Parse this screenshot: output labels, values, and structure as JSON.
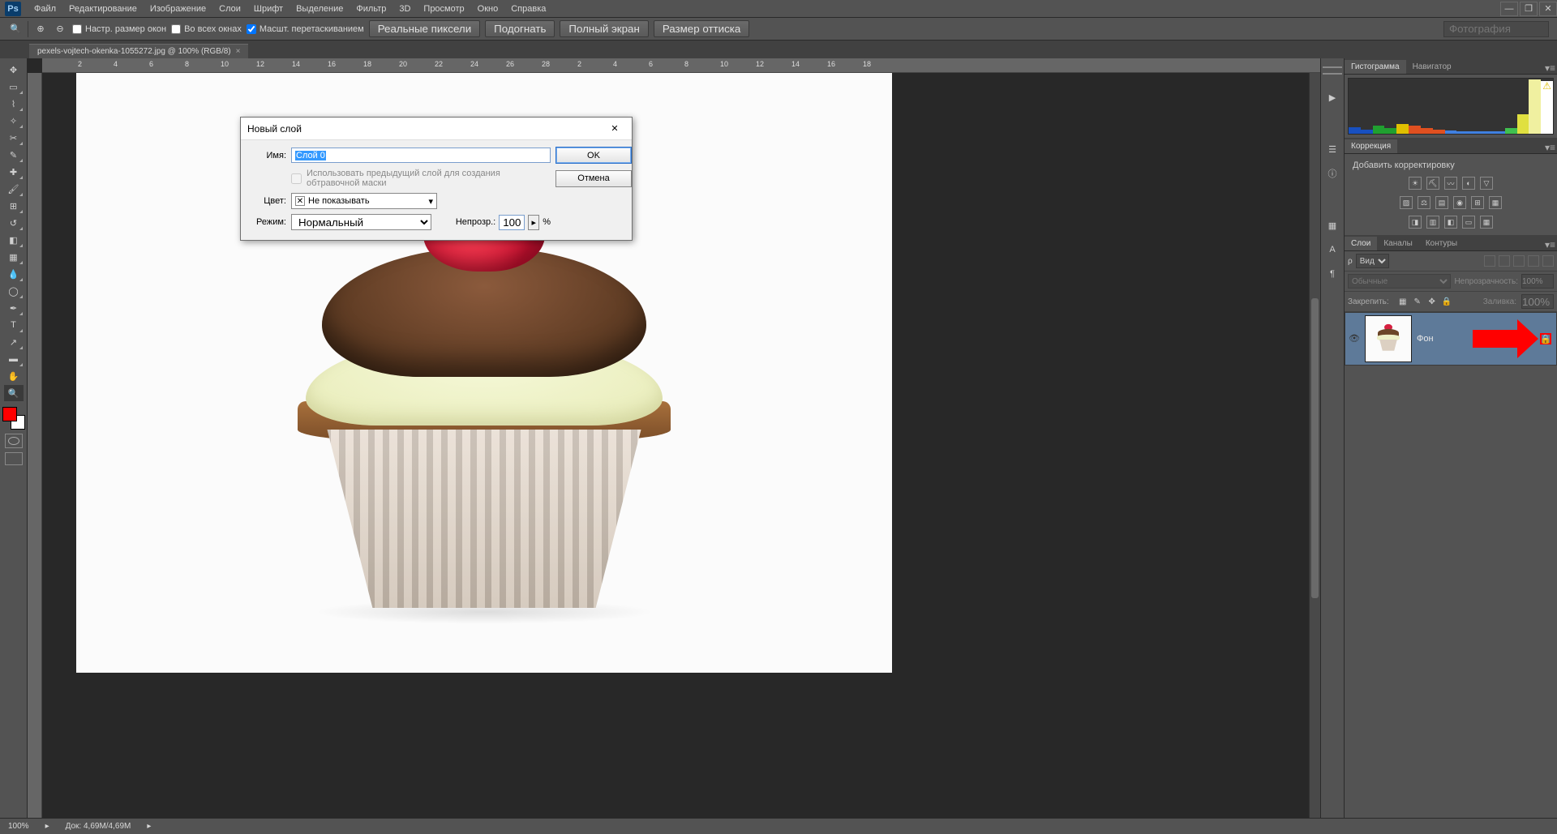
{
  "menu": [
    "Файл",
    "Редактирование",
    "Изображение",
    "Слои",
    "Шрифт",
    "Выделение",
    "Фильтр",
    "3D",
    "Просмотр",
    "Окно",
    "Справка"
  ],
  "options": {
    "resize_windows": "Настр. размер окон",
    "all_windows": "Во всех окнах",
    "scrub_zoom": "Масшт. перетаскиванием",
    "btn_actual": "Реальные пиксели",
    "btn_fit": "Подогнать",
    "btn_full": "Полный экран",
    "btn_print": "Размер оттиска",
    "search_placeholder": "Фотография"
  },
  "document": {
    "tab": "pexels-vojtech-okenka-1055272.jpg @ 100% (RGB/8)"
  },
  "ruler_ticks": [
    "2",
    "4",
    "6",
    "8",
    "10",
    "12",
    "14",
    "16",
    "18",
    "20",
    "22",
    "24",
    "26",
    "28",
    "2",
    "4",
    "6",
    "8",
    "10",
    "12",
    "14",
    "16",
    "18"
  ],
  "panels": {
    "hist_tab": "Гистограмма",
    "nav_tab": "Навигатор",
    "corr_tab": "Коррекция",
    "corr_add": "Добавить корректировку",
    "layers_tab": "Слои",
    "channels_tab": "Каналы",
    "paths_tab": "Контуры",
    "layer_kind": "Вид",
    "blend_mode": "Обычные",
    "opacity_label": "Непрозрачность:",
    "opacity_val": "100%",
    "lock_label": "Закрепить:",
    "fill_label": "Заливка:",
    "fill_val": "100%",
    "layer0_name": "Фон"
  },
  "dialog": {
    "title": "Новый слой",
    "name_label": "Имя:",
    "name_value": "Слой 0",
    "clip_mask": "Использовать предыдущий слой для создания обтравочной маски",
    "color_label": "Цвет:",
    "color_value": "Не показывать",
    "mode_label": "Режим:",
    "mode_value": "Нормальный",
    "opacity_label": "Непрозр.:",
    "opacity_value": "100",
    "percent": "%",
    "ok": "OK",
    "cancel": "Отмена"
  },
  "status": {
    "zoom": "100%",
    "docsize": "Док: 4,69M/4,69M"
  }
}
